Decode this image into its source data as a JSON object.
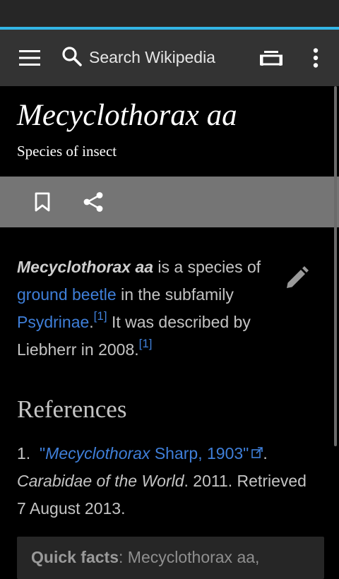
{
  "toolbar": {
    "menu_icon": "hamburger-menu-icon",
    "search_icon": "magnifier-icon",
    "search_label": "Search Wikipedia",
    "tabs_icon": "tabs-icon",
    "overflow_icon": "overflow-menu-icon"
  },
  "header": {
    "title": "Mecyclothorax aa",
    "subtitle": "Species of insect"
  },
  "actions": {
    "bookmark_icon": "bookmark-icon",
    "share_icon": "share-icon"
  },
  "article": {
    "lead_bold": "Mecyclothorax aa",
    "text_1": " is a species of ",
    "link_ground_beetle": "ground beetle",
    "text_2": " in the subfamily ",
    "link_psydrinae": "Psydrinae",
    "text_3": ".",
    "cite_1": "[1]",
    "text_4": " It was described by Liebherr in 2008.",
    "cite_2": "[1]",
    "edit_icon": "pencil-icon"
  },
  "references": {
    "heading": "References",
    "items": [
      {
        "number": "1.",
        "open_quote": "\"",
        "link_italic": "Mecyclothorax",
        "link_rest": " Sharp, 1903\"",
        "external_icon": "external-link-icon",
        "after_link": ".",
        "work": "Carabidae of the World",
        "rest": ". 2011. Retrieved 7 August 2013."
      }
    ]
  },
  "quick_facts": {
    "label": "Quick facts",
    "text": ": Mecyclothorax aa,"
  },
  "colors": {
    "accent": "#33b5e5",
    "link": "#3f7fd9",
    "toolbar": "#333333",
    "action_bar": "#757575"
  }
}
